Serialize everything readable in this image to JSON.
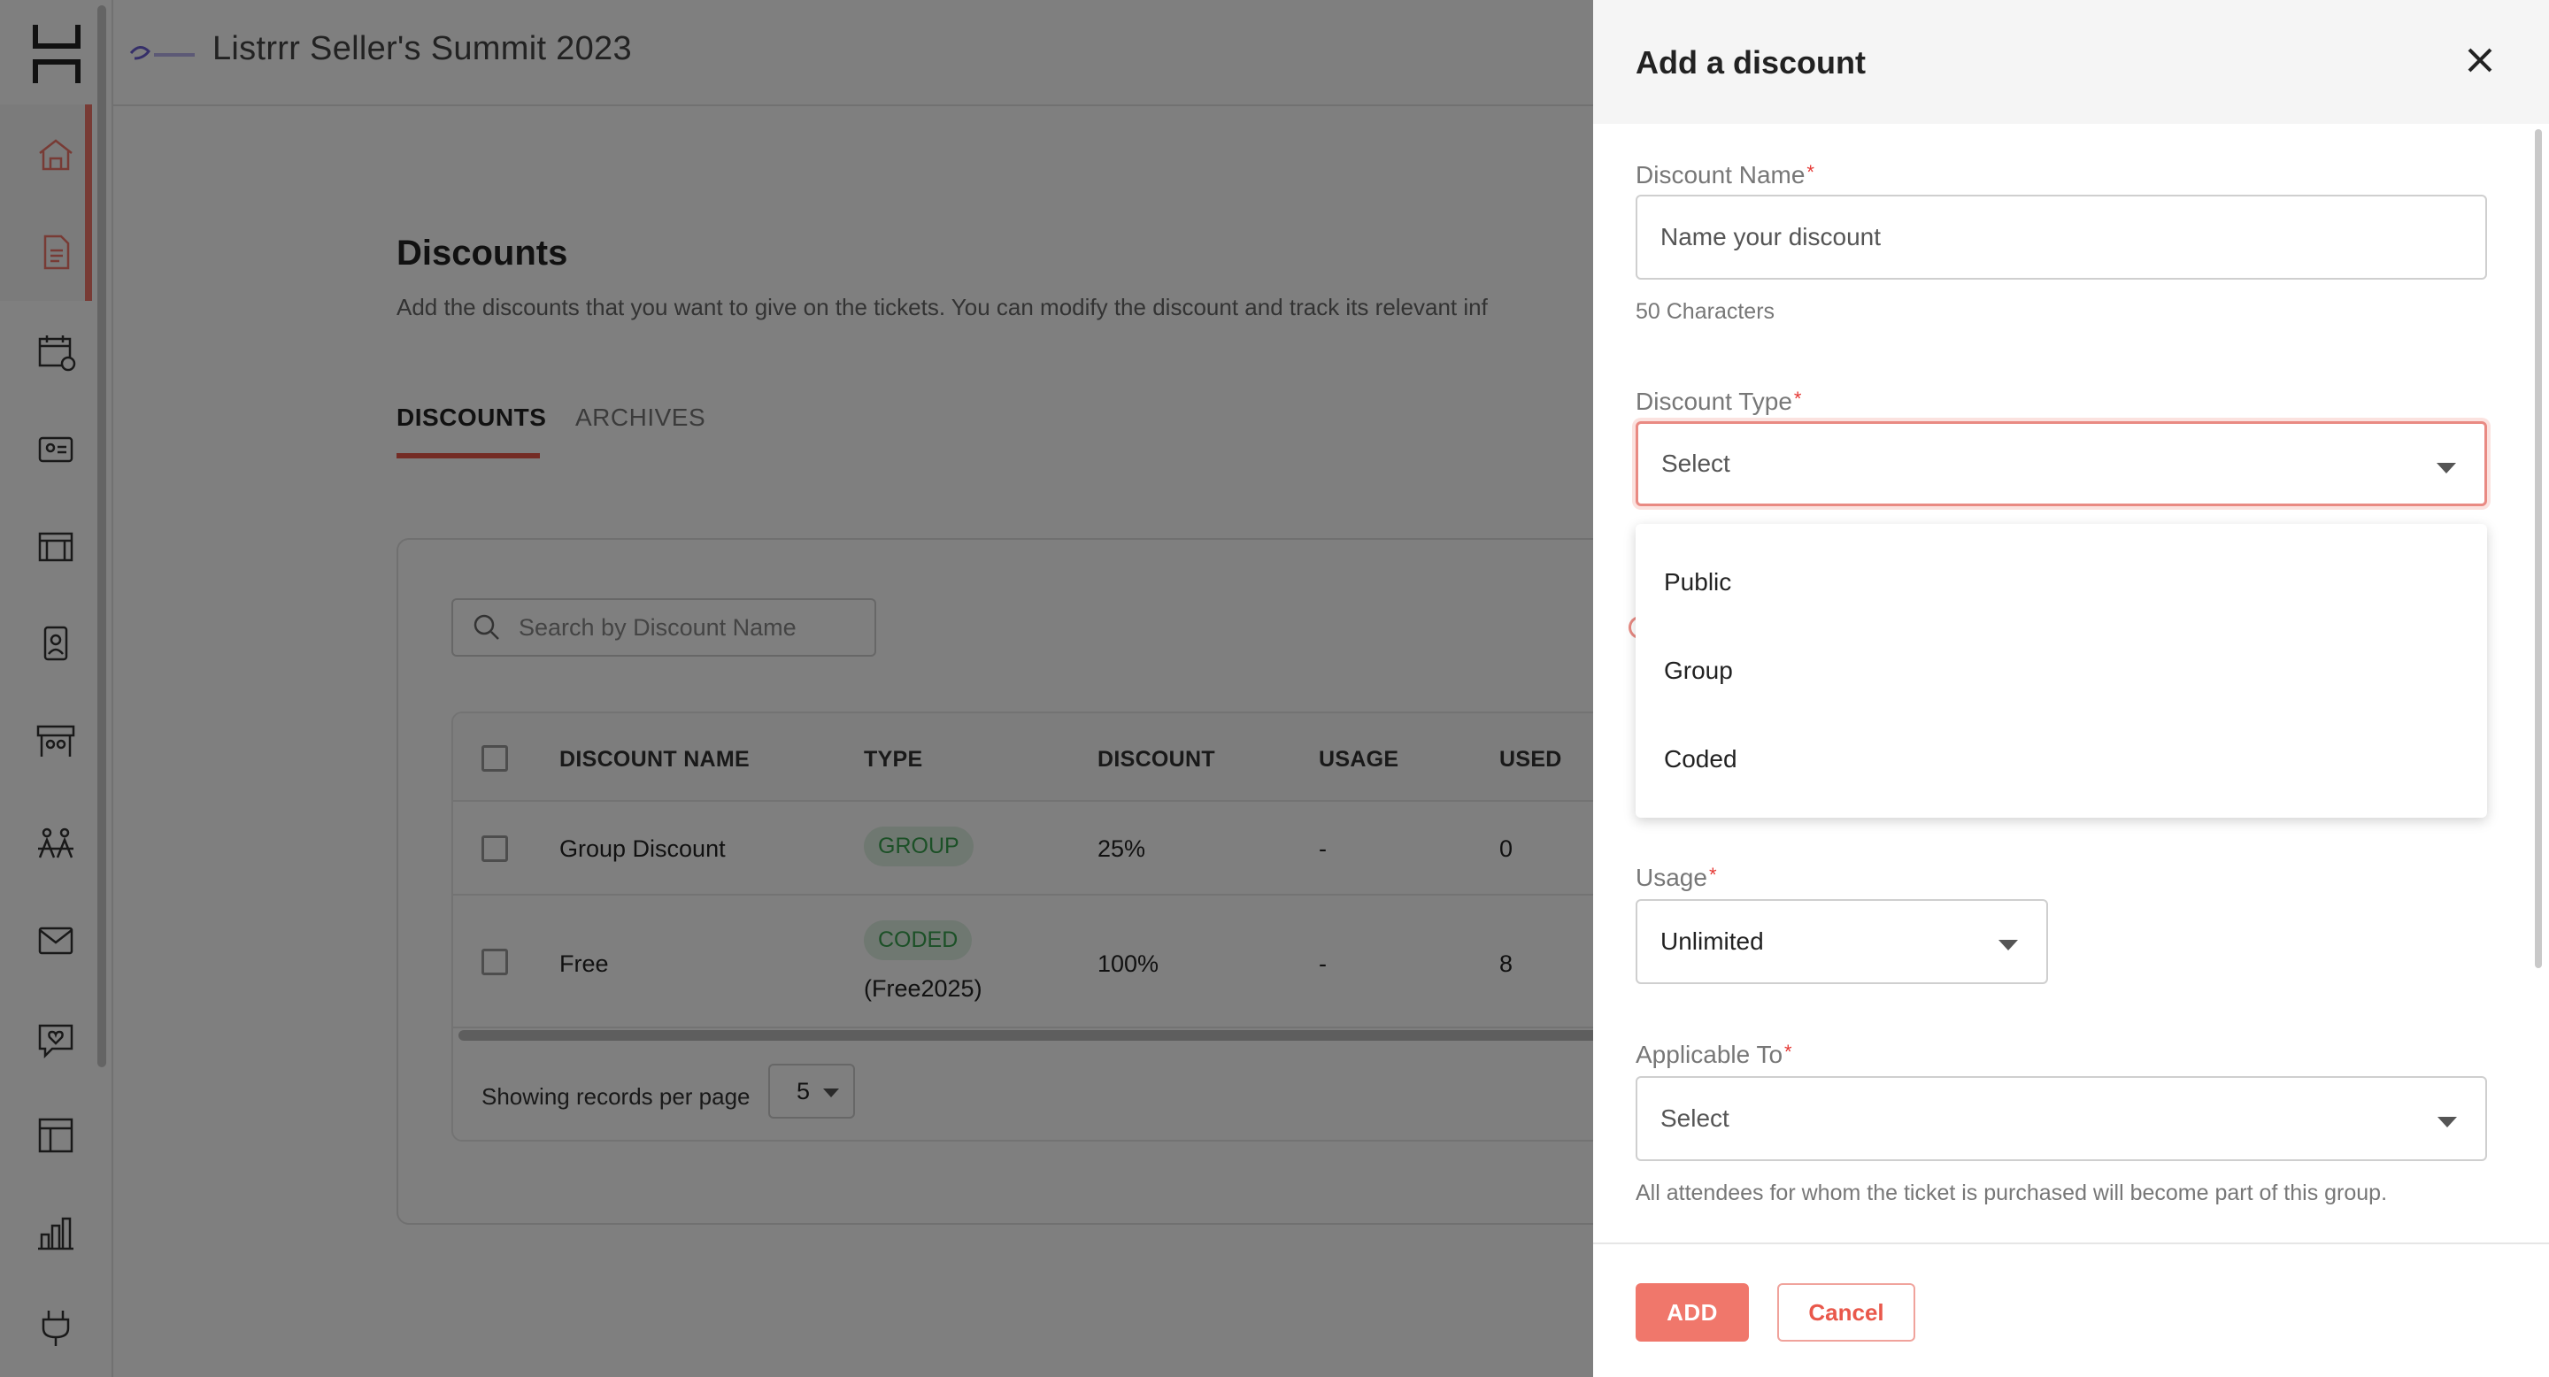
{
  "header": {
    "event_title": "Listrrr Seller's Summit 2023"
  },
  "page": {
    "title": "Discounts",
    "description": "Add the discounts that you want to give on the tickets. You can modify the discount and track its relevant inf",
    "tabs": [
      {
        "label": "DISCOUNTS",
        "active": true
      },
      {
        "label": "ARCHIVES",
        "active": false
      }
    ]
  },
  "search": {
    "placeholder": "Search by Discount Name"
  },
  "table": {
    "columns": [
      "DISCOUNT NAME",
      "TYPE",
      "DISCOUNT",
      "USAGE",
      "USED"
    ],
    "rows": [
      {
        "name": "Group Discount",
        "type": "GROUP",
        "code": "",
        "discount": "25%",
        "usage": "-",
        "used": "0"
      },
      {
        "name": "Free",
        "type": "CODED",
        "code": "(Free2025)",
        "discount": "100%",
        "usage": "-",
        "used": "8"
      }
    ],
    "footer_label": "Showing records per page",
    "per_page": "5"
  },
  "drawer": {
    "title": "Add a discount",
    "discount_name": {
      "label": "Discount Name",
      "placeholder": "Name your discount",
      "helper": "50 Characters"
    },
    "discount_type": {
      "label": "Discount Type",
      "value": "Select",
      "options": [
        "Public",
        "Group",
        "Coded"
      ]
    },
    "usage": {
      "label": "Usage",
      "value": "Unlimited"
    },
    "applicable_to": {
      "label": "Applicable To",
      "value": "Select",
      "helper": "All attendees for whom the ticket is purchased will become part of this group."
    },
    "add_label": "ADD",
    "cancel_label": "Cancel"
  },
  "colors": {
    "accent": "#f0776b",
    "badge_bg": "#dff1e2",
    "badge_text": "#39a14e"
  }
}
